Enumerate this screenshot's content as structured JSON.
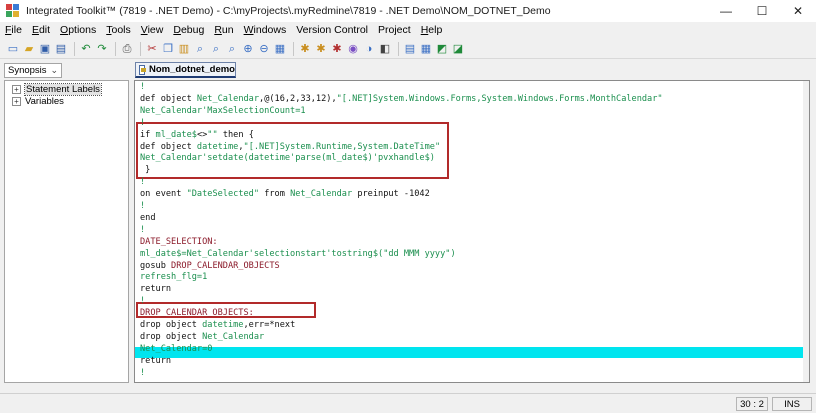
{
  "window": {
    "title": "Integrated Toolkit™  (7819 - .NET Demo) - C:\\myProjects\\.myRedmine\\7819 - .NET Demo\\NOM_DOTNET_Demo",
    "controls": {
      "minimize": "—",
      "maximize": "☐",
      "close": "✕"
    }
  },
  "menu": [
    {
      "u": "F",
      "rest": "ile"
    },
    {
      "u": "E",
      "rest": "dit"
    },
    {
      "u": "O",
      "rest": "ptions"
    },
    {
      "u": "T",
      "rest": "ools"
    },
    {
      "u": "V",
      "rest": "iew"
    },
    {
      "u": "D",
      "rest": "ebug"
    },
    {
      "u": "R",
      "rest": "un"
    },
    {
      "u": "W",
      "rest": "indows"
    },
    {
      "u": "",
      "rest": "Version Control"
    },
    {
      "u": "",
      "rest": "Project"
    },
    {
      "u": "H",
      "rest": "elp"
    }
  ],
  "toolbar_icons": [
    "new-file-icon",
    "open-folder-icon",
    "save-icon",
    "save-all-icon",
    "undo-icon",
    "redo-icon",
    "print-icon",
    "cut-icon",
    "copy-icon",
    "paste-icon",
    "find-icon",
    "find-next-icon",
    "replace-icon",
    "zoom-in-icon",
    "zoom-out-icon",
    "goto-icon",
    "compile-icon",
    "run-icon",
    "debug-icon",
    "step-icon",
    "breakpoint-icon",
    "stop-icon",
    "window-icon",
    "panel-icon",
    "settings-icon",
    "export-icon"
  ],
  "sidebar": {
    "select_value": "Synopsis",
    "tree": [
      {
        "expander": "+",
        "label": "Statement Labels",
        "selected": true
      },
      {
        "expander": "+",
        "label": "Variables",
        "selected": false
      }
    ]
  },
  "tab": {
    "label": "Nom_dotnet_demo"
  },
  "code": [
    [
      [
        "cm",
        "!"
      ]
    ],
    [
      [
        "kw",
        "def object "
      ],
      [
        "ty",
        "Net_Calendar"
      ],
      [
        "kw",
        ",@(16,2,33,12),"
      ],
      [
        "st",
        "\"[.NET]System.Windows.Forms,System.Windows.Forms.MonthCalendar\""
      ]
    ],
    [
      [
        "ty",
        "Net_Calendar'MaxSelectionCount=1"
      ]
    ],
    [
      [
        "cm",
        "!"
      ]
    ],
    [
      [
        "kw",
        "if "
      ],
      [
        "ty",
        "ml_date$"
      ],
      [
        "kw",
        "<>"
      ],
      [
        "st",
        "\"\""
      ],
      [
        "kw",
        " then {"
      ]
    ],
    [
      [
        "kw",
        "def object "
      ],
      [
        "ty",
        "datetime"
      ],
      [
        "kw",
        ","
      ],
      [
        "st",
        "\"[.NET]System.Runtime,System.DateTime\""
      ]
    ],
    [
      [
        "ty",
        "Net_Calendar'setdate(datetime'parse(ml_date$)'pvxhandle$)"
      ]
    ],
    [
      [
        "kw",
        " }"
      ]
    ],
    [
      [
        "cm",
        "!"
      ]
    ],
    [
      [
        "kw",
        "on event "
      ],
      [
        "st",
        "\"DateSelected\""
      ],
      [
        "kw",
        " from "
      ],
      [
        "ty",
        "Net_Calendar"
      ],
      [
        "kw",
        " preinput -1042"
      ]
    ],
    [
      [
        "cm",
        "!"
      ]
    ],
    [
      [
        "kw",
        "end"
      ]
    ],
    [
      [
        "cm",
        "!"
      ]
    ],
    [
      [
        "lb",
        "DATE_SELECTION:"
      ]
    ],
    [
      [
        "ty",
        "ml_date$=Net_Calendar'selectionstart'tostring$("
      ],
      [
        "st",
        "\"dd MMM yyyy\""
      ],
      [
        "ty",
        ")"
      ]
    ],
    [
      [
        "kw",
        "gosub "
      ],
      [
        "lb",
        "DROP_CALENDAR_OBJECTS"
      ]
    ],
    [
      [
        "ty",
        "refresh_flg=1"
      ]
    ],
    [
      [
        "kw",
        "return"
      ]
    ],
    [
      [
        "cm",
        "!"
      ]
    ],
    [
      [
        "lb",
        "DROP_CALENDAR_OBJECTS:"
      ]
    ],
    [
      [
        "kw",
        "drop object "
      ],
      [
        "ty",
        "datetime"
      ],
      [
        "kw",
        ",err=*next"
      ]
    ],
    [
      [
        "kw",
        "drop object "
      ],
      [
        "ty",
        "Net_Calendar"
      ]
    ],
    [
      [
        "ty",
        "Net_Calendar=0"
      ]
    ],
    [
      [
        "kw",
        "return"
      ]
    ],
    [
      [
        "cm",
        "!"
      ]
    ]
  ],
  "status": {
    "position": "30 : 2",
    "mode": "INS"
  }
}
